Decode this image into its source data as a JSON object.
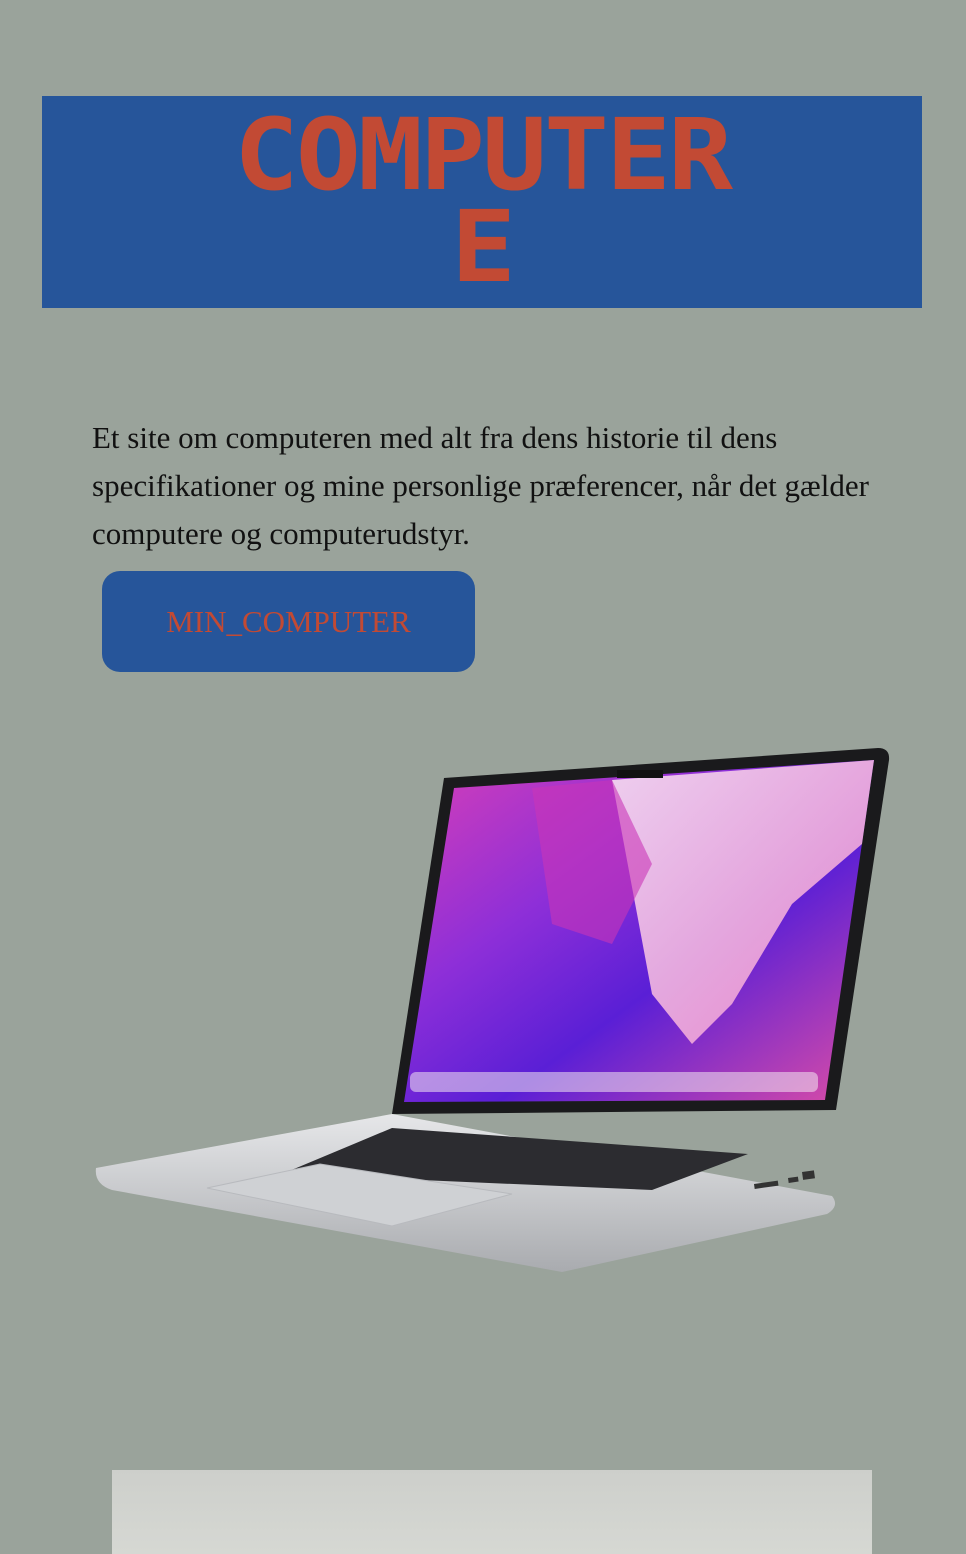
{
  "header": {
    "title_line1": "COMPUTER",
    "title_line2": "E"
  },
  "intro": {
    "text": "Et site om computeren med alt fra dens historie til dens specifikationer og mine personlige præferencer, når det gælder computere og computerudstyr."
  },
  "cta": {
    "label": "MIN_COMPUTER"
  },
  "colors": {
    "background": "#9aa39b",
    "accent_blue": "#26559a",
    "accent_red": "#c24a34"
  }
}
